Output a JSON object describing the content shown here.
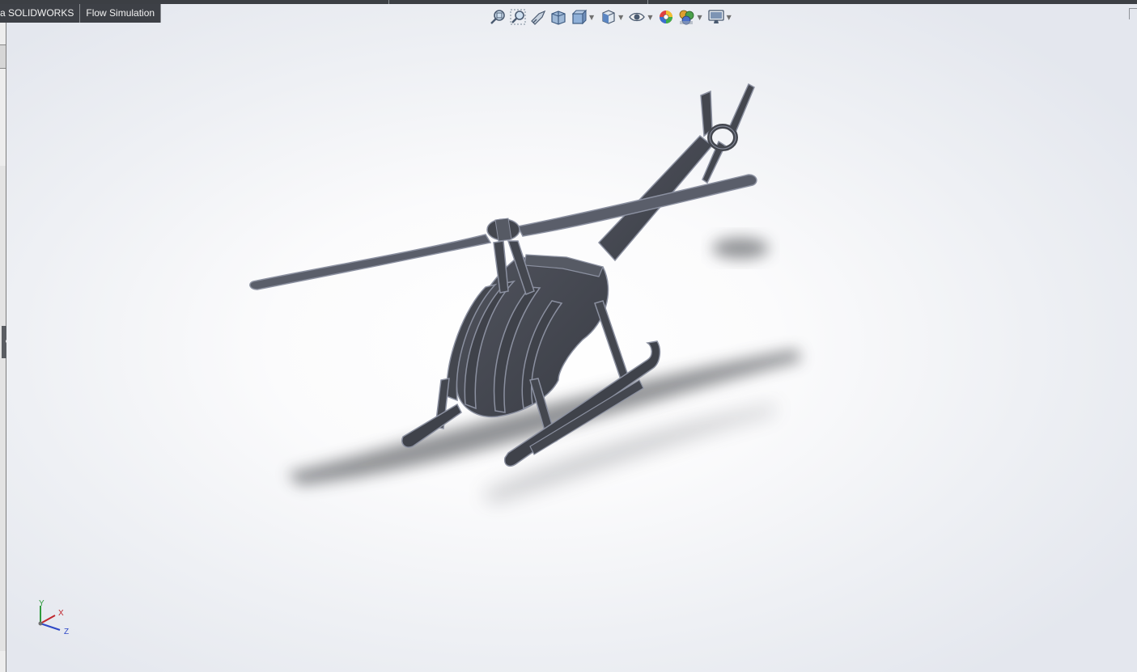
{
  "tabs": [
    {
      "label": "a SOLIDWORKS"
    },
    {
      "label": "Flow Simulation"
    }
  ],
  "hud_toolbar": [
    {
      "icon": "zoom-to-fit-icon",
      "dropdown": false
    },
    {
      "icon": "zoom-to-area-icon",
      "dropdown": false
    },
    {
      "icon": "previous-view-icon",
      "dropdown": false
    },
    {
      "icon": "section-view-icon",
      "dropdown": false
    },
    {
      "icon": "dynamic-annotation-views-icon",
      "dropdown": true
    },
    {
      "icon": "view-orientation-icon",
      "dropdown": true
    },
    {
      "icon": "hide-show-items-icon",
      "dropdown": true
    },
    {
      "icon": "edit-appearance-icon",
      "dropdown": false
    },
    {
      "icon": "apply-scene-icon",
      "dropdown": true
    },
    {
      "icon": "view-settings-icon",
      "dropdown": true
    }
  ],
  "triad": {
    "x_label": "X",
    "y_label": "Y",
    "z_label": "Z",
    "colors": {
      "x": "#c0262d",
      "y": "#2e9a3b",
      "z": "#2f49c7"
    }
  },
  "colors": {
    "model_body": "#44474f",
    "model_edge": "#8b90a0",
    "model_highlight": "#6c7182",
    "tab_bg": "#3d4046",
    "tab_text": "#f2f2f2"
  }
}
